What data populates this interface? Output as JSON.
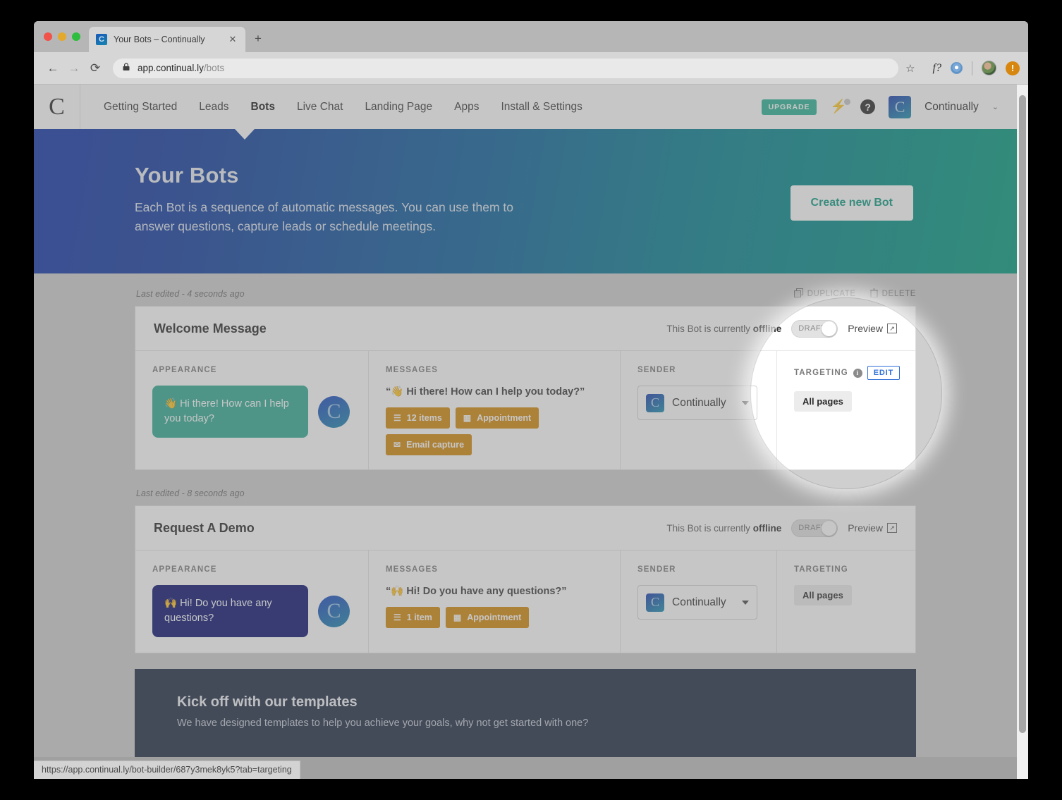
{
  "browser": {
    "tab": {
      "title": "Your Bots – Continually",
      "favicon": "C",
      "close_icon": "✕"
    },
    "new_tab_icon": "+",
    "nav": {
      "back_icon": "←",
      "forward_icon": "→",
      "reload_icon": "⟳"
    },
    "omnibox": {
      "lock_icon": "lock",
      "url_host": "app.continual.ly",
      "url_path": "/bots",
      "star_icon": "☆"
    },
    "toolbar_icons": [
      "f?",
      "extension-blue-icon",
      "profile-avatar",
      "update-alert"
    ],
    "alert_badge_label": "!",
    "status_bar_url": "https://app.continual.ly/bot-builder/687y3mek8yk5?tab=targeting"
  },
  "appnav": {
    "logo": "C",
    "links": [
      {
        "label": "Getting Started",
        "active": false
      },
      {
        "label": "Leads",
        "active": false
      },
      {
        "label": "Bots",
        "active": true
      },
      {
        "label": "Live Chat",
        "active": false
      },
      {
        "label": "Landing Page",
        "active": false
      },
      {
        "label": "Apps",
        "active": false
      },
      {
        "label": "Install & Settings",
        "active": false
      }
    ],
    "upgrade_label": "UPGRADE",
    "bolt_icon": "⚡",
    "help_icon": "?",
    "account_logo": "C",
    "account_name": "Continually",
    "account_caret": "⌄"
  },
  "hero": {
    "title": "Your Bots",
    "subtitle": "Each Bot is a sequence of automatic messages. You can use them to answer questions, capture leads or schedule meetings.",
    "cta_label": "Create new Bot",
    "gradient_from": "#1033a8",
    "gradient_to": "#009b7d",
    "cta_color": "#0f9c84"
  },
  "column_labels": {
    "appearance": "APPEARANCE",
    "messages": "MESSAGES",
    "sender": "SENDER",
    "targeting": "TARGETING"
  },
  "bots": [
    {
      "meta": "Last edited - 4 seconds ago",
      "duplicate_label": "DUPLICATE",
      "delete_label": "DELETE",
      "name": "Welcome Message",
      "status_prefix": "This Bot is currently",
      "status_value": "offline",
      "toggle_label": "DRAFT",
      "preview_label": "Preview",
      "bubble_text": "👋 Hi there! How can I help you today?",
      "bubble_color": "#31ab94",
      "avatar": "C",
      "message_quote": "“👋 Hi there! How can I help you today?”",
      "chips": [
        {
          "icon": "list-icon",
          "glyph": "☰",
          "label": "12 items"
        },
        {
          "icon": "calendar-icon",
          "glyph": "▦",
          "label": "Appointment"
        },
        {
          "icon": "envelope-icon",
          "glyph": "✉",
          "label": "Email capture"
        }
      ],
      "sender_logo": "C",
      "sender_name": "Continually",
      "targeting_info_icon": "i",
      "targeting_edit_label": "EDIT",
      "targeting_tag": "All pages",
      "highlighted": true
    },
    {
      "meta": "Last edited - 8 seconds ago",
      "name": "Request A Demo",
      "status_prefix": "This Bot is currently",
      "status_value": "offline",
      "toggle_label": "DRAFT",
      "preview_label": "Preview",
      "bubble_text": "🙌 Hi! Do you have any questions?",
      "bubble_color": "#0b1270",
      "avatar": "C",
      "message_quote": "“🙌 Hi! Do you have any questions?”",
      "chips": [
        {
          "icon": "list-icon",
          "glyph": "☰",
          "label": "1 item"
        },
        {
          "icon": "calendar-icon",
          "glyph": "▦",
          "label": "Appointment"
        }
      ],
      "sender_logo": "C",
      "sender_name": "Continually",
      "targeting_tag": "All pages",
      "highlighted": false
    }
  ],
  "templates": {
    "title": "Kick off with our templates",
    "subtitle": "We have designed templates to help you achieve your goals, why not get started with one?"
  }
}
